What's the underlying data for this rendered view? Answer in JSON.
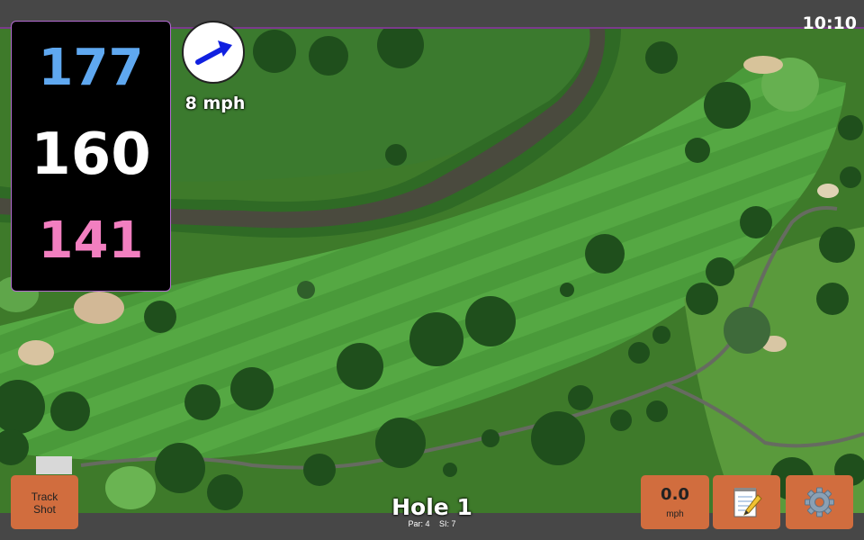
{
  "status_bar": {
    "time": "10:10"
  },
  "distances": {
    "back": "177",
    "middle": "160",
    "front": "141"
  },
  "wind": {
    "speed_label": "8 mph",
    "direction": "east-north-east"
  },
  "hole": {
    "title": "Hole 1",
    "par_label": "Par: 4",
    "si_label": "SI: 7"
  },
  "buttons": {
    "track_shot_line1": "Track",
    "track_shot_line2": "Shot",
    "speed_value": "0.0",
    "speed_unit": "mph",
    "notes_icon": "notepad-pencil-icon",
    "settings_icon": "gear-icon"
  },
  "colors": {
    "back_distance": "#5fa8f0",
    "middle_distance": "#ffffff",
    "front_distance": "#f27fc0",
    "button_fill": "#d16d3e",
    "panel_border": "#b26bd0",
    "wind_arrow": "#1020e0"
  }
}
